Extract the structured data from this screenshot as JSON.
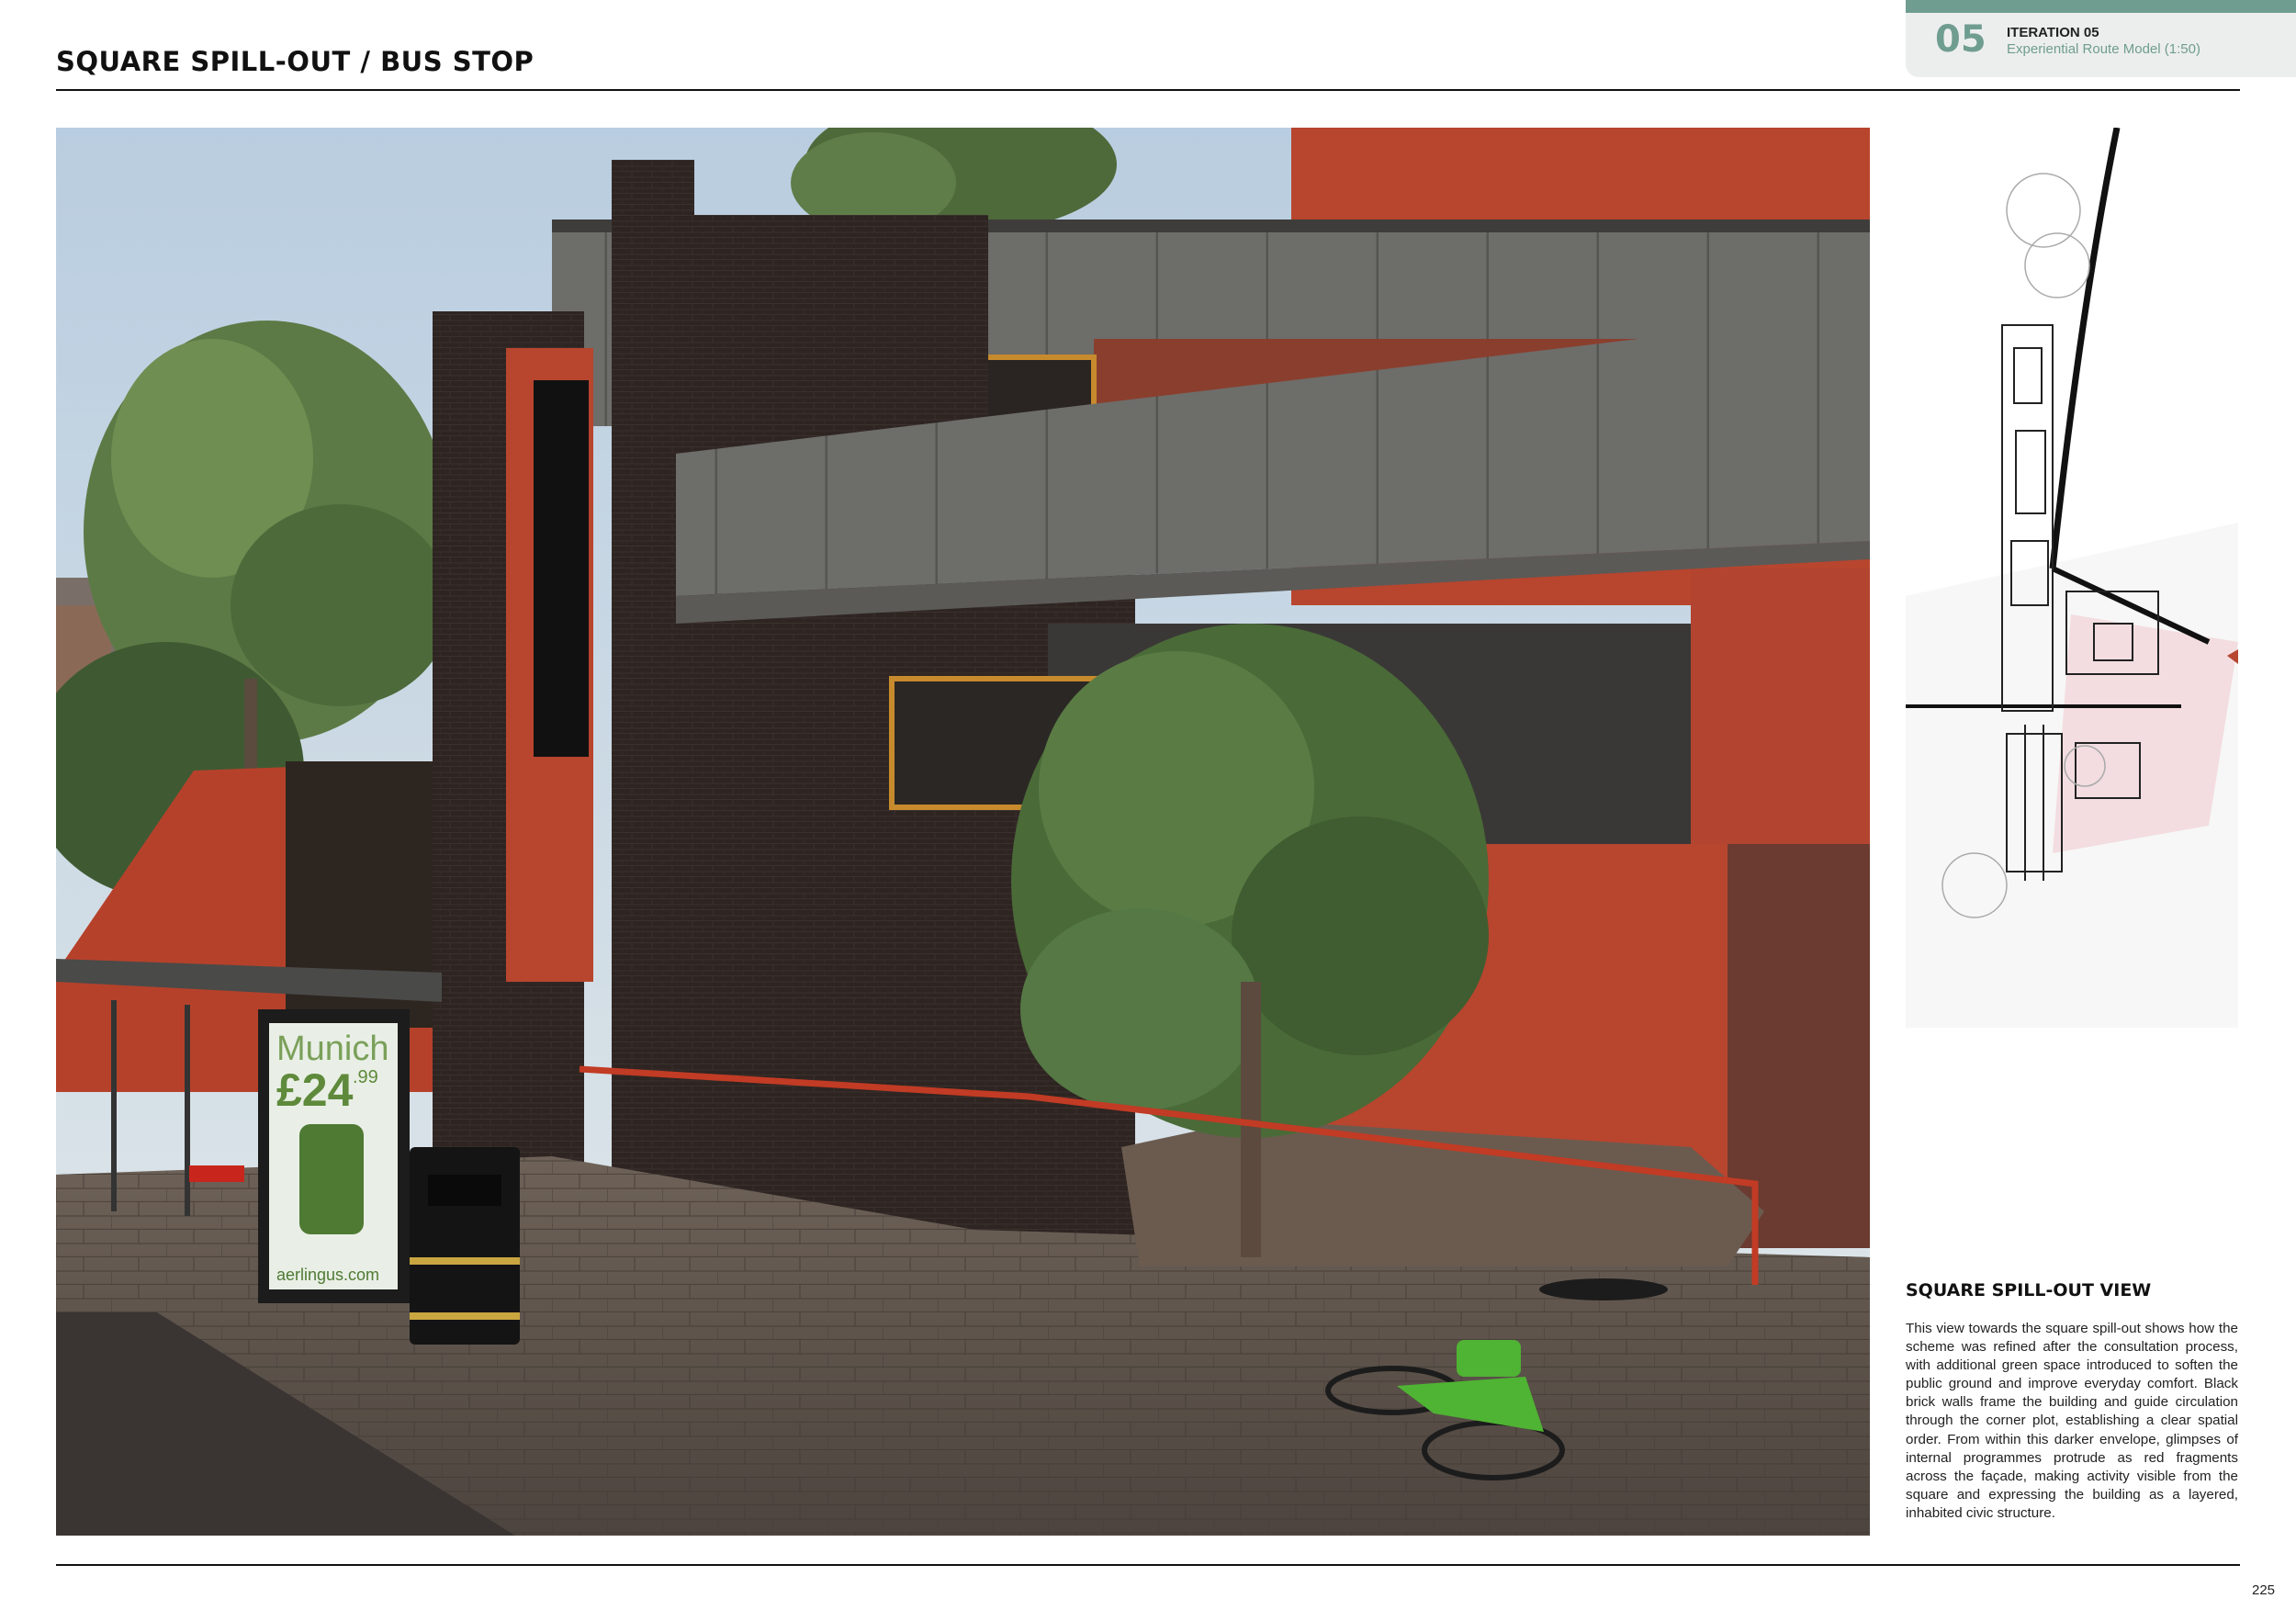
{
  "header": {
    "title": "SQUARE SPILL-OUT / BUS STOP",
    "iteration_number": "05",
    "iteration_title": "ITERATION 05",
    "iteration_subtitle": "Experiential Route Model (1:50)"
  },
  "render": {
    "poster_line1": "Munich",
    "poster_price": "£24",
    "poster_cents": ".99",
    "poster_url": "aerlingus.com"
  },
  "sidebar": {
    "heading": "SQUARE SPILL-OUT VIEW",
    "body": "This view towards the square spill-out shows how the scheme was refined after the consultation process, with additional green space introduced to soften the public ground and improve everyday comfort. Black brick walls frame the building and guide circulation through the corner plot, establishing a clear spatial order. From within this darker envelope, glimpses of internal programmes protrude as red fragments across the façade, making activity visible from the square and expressing the building as a layered, inhabited civic structure."
  },
  "footer": {
    "page_number": "225"
  },
  "colors": {
    "accent": "#6f9d90",
    "brick_black": "#2e2522",
    "terracotta": "#b8452e",
    "concrete": "#6d6d6a"
  }
}
